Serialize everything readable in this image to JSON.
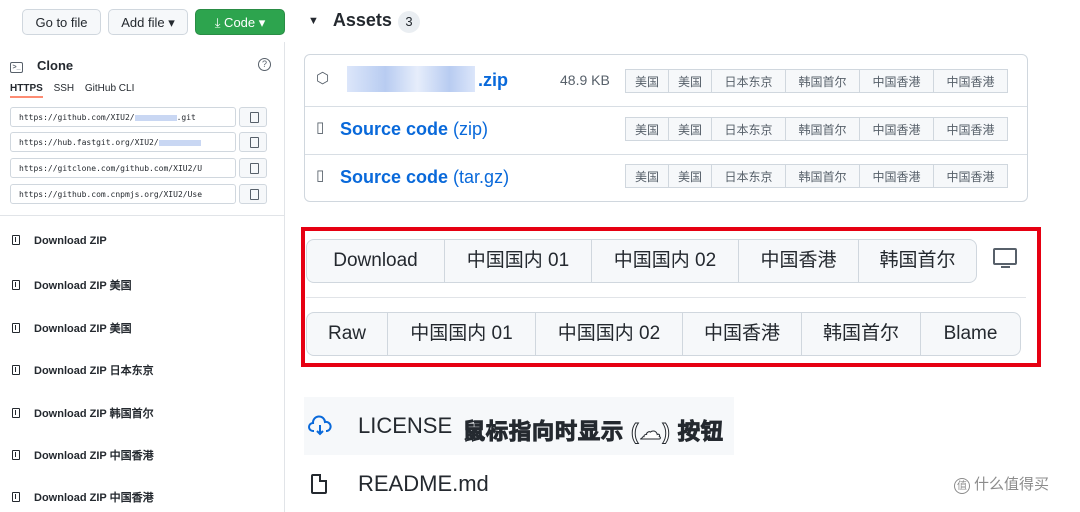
{
  "toolbar": {
    "goto_file": "Go to file",
    "add_file": "Add file ▾",
    "code": "⤓ Code ▾"
  },
  "clone": {
    "title": "Clone",
    "tabs": [
      "HTTPS",
      "SSH",
      "GitHub CLI"
    ],
    "urls": [
      {
        "prefix": "https://github.com/XIU2/",
        "suffix": ".git"
      },
      {
        "prefix": "https://hub.fastgit.org/XIU2/",
        "suffix": ""
      },
      {
        "prefix": "https://gitclone.com/github.com/XIU2/U",
        "suffix": ""
      },
      {
        "prefix": "https://github.com.cnpmjs.org/XIU2/Use",
        "suffix": ""
      }
    ],
    "downloads": [
      "Download ZIP",
      "Download ZIP 美国",
      "Download ZIP 美国",
      "Download ZIP 日本东京",
      "Download ZIP 韩国首尔",
      "Download ZIP 中国香港",
      "Download ZIP 中国香港"
    ]
  },
  "assets": {
    "title": "Assets",
    "count": "3",
    "rows": [
      {
        "name": ".zip",
        "sub": "",
        "size": "48.9 KB",
        "icon": "package-icon"
      },
      {
        "name": "Source code",
        "sub": " (zip)",
        "size": "",
        "icon": "file-zip-icon"
      },
      {
        "name": "Source code",
        "sub": " (tar.gz)",
        "size": "",
        "icon": "file-zip-icon"
      }
    ],
    "mirrors": [
      "美国",
      "美国",
      "日本东京",
      "韩国首尔",
      "中国香港",
      "中国香港"
    ]
  },
  "file_buttons_row1": [
    "Download",
    "中国国内 01",
    "中国国内 02",
    "中国香港",
    "韩国首尔"
  ],
  "file_buttons_row2": [
    "Raw",
    "中国国内 01",
    "中国国内 02",
    "中国香港",
    "韩国首尔",
    "Blame"
  ],
  "files": {
    "license": "LICENSE",
    "readme": "README.md",
    "annotation": "鼠标指向时显示 (☁) 按钮"
  },
  "watermark": "什么值得买",
  "colors": {
    "accent_green": "#2da44e",
    "link_blue": "#0969da",
    "highlight_red": "#e60012"
  }
}
